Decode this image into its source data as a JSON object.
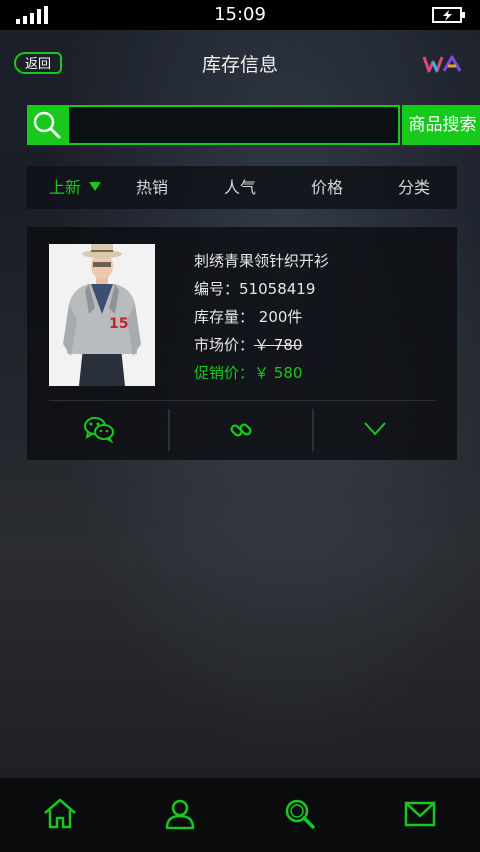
{
  "status_bar": {
    "time": "15:09"
  },
  "header": {
    "back_label": "返回",
    "title": "库存信息"
  },
  "search": {
    "value": "",
    "button_label": "商品搜索"
  },
  "tabs": [
    {
      "label": "上新",
      "active": true
    },
    {
      "label": "热销"
    },
    {
      "label": "人气"
    },
    {
      "label": "价格"
    },
    {
      "label": "分类"
    }
  ],
  "product": {
    "name": "刺绣青果领针织开衫",
    "code_label": "编号：",
    "code": "51058419",
    "stock_label": "库存量：",
    "stock": "200件",
    "market_label": "市场价：",
    "market_price": "￥ 780",
    "promo_label": "促销价：",
    "promo_price": "￥ 580"
  },
  "colors": {
    "accent": "#19c81c"
  }
}
